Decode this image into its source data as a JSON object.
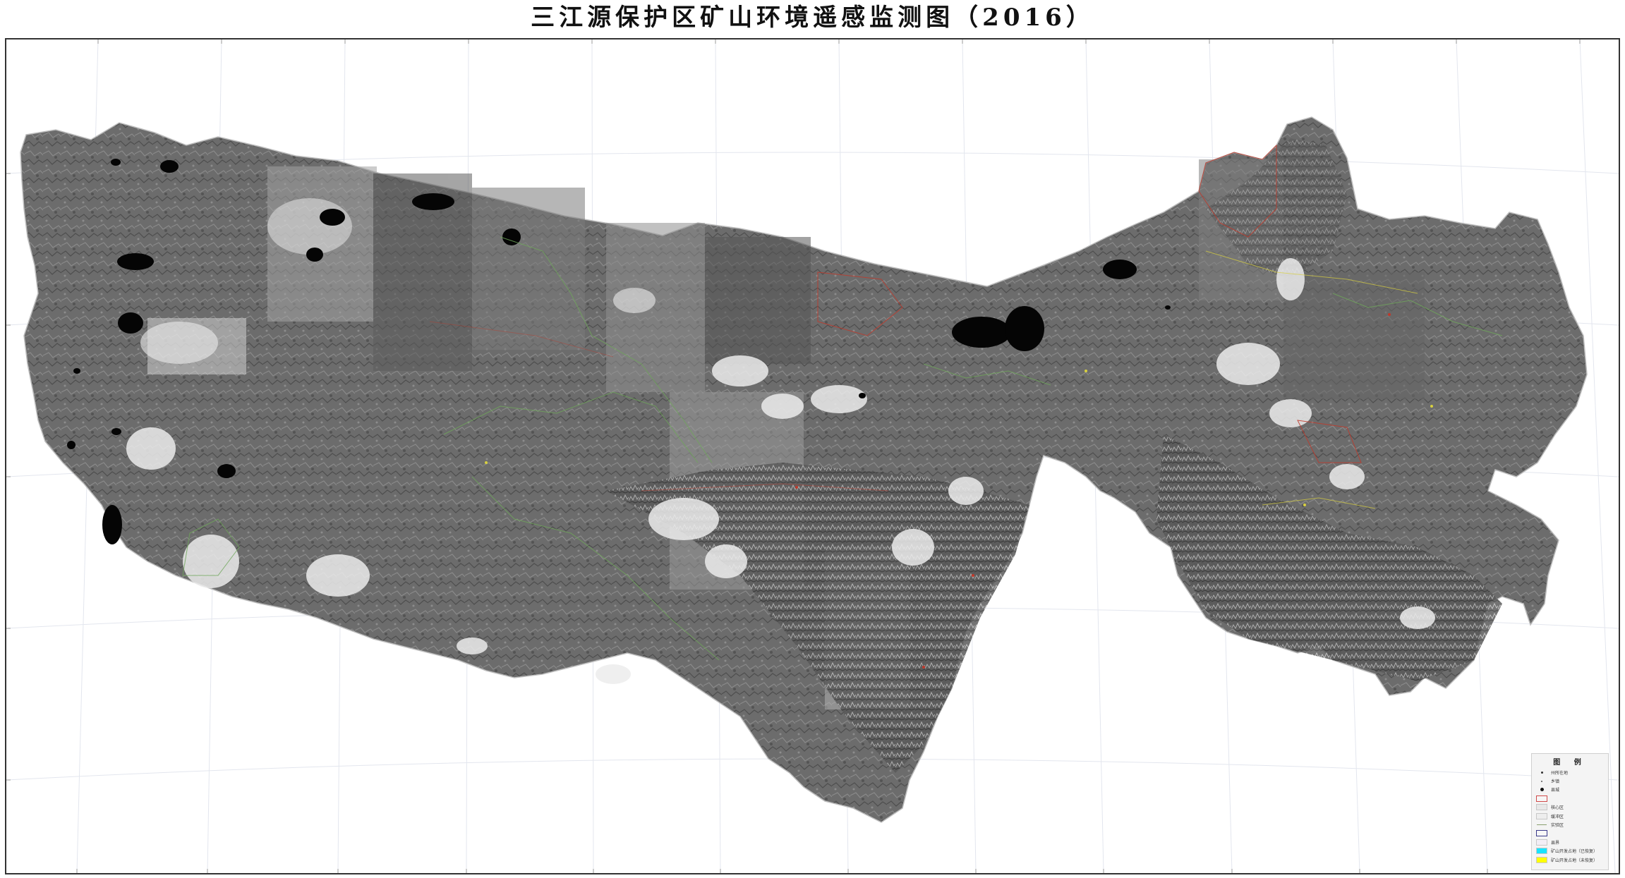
{
  "title": "三江源保护区矿山环境遥感监测图（2016）",
  "legend": {
    "title": "图 例",
    "items": [
      {
        "label": "州所在地",
        "symbol": "dot",
        "color": "#333333"
      },
      {
        "label": "乡镇",
        "symbol": "dot-small",
        "color": "#555555"
      },
      {
        "label": "县城",
        "symbol": "dot-big",
        "color": "#111111"
      },
      {
        "label": "",
        "symbol": "box-outline",
        "color": "#d04a4a"
      },
      {
        "label": "核心区",
        "symbol": "fill",
        "color": "#e8e8e8"
      },
      {
        "label": "缓冲区",
        "symbol": "fill",
        "color": "#eeeeee"
      },
      {
        "label": "实验区",
        "symbol": "line",
        "color": "#8aa06f"
      },
      {
        "label": "",
        "symbol": "box-outline",
        "color": "#3a3a8a"
      },
      {
        "label": "县界",
        "symbol": "fill",
        "color": "#f2eef6"
      },
      {
        "label": "矿山开发占地（已恢复）",
        "symbol": "fill",
        "color": "#17e4ff"
      },
      {
        "label": "矿山开发占地（未恢复）",
        "symbol": "fill",
        "color": "#ffff00"
      }
    ]
  },
  "colors": {
    "imagery_base": "#6e6e6e",
    "lakes": "#050505",
    "snow": "#efefef",
    "boundary_red": "#c0392b",
    "boundary_green": "#6fa85a",
    "boundary_yellow": "#d8d040"
  }
}
